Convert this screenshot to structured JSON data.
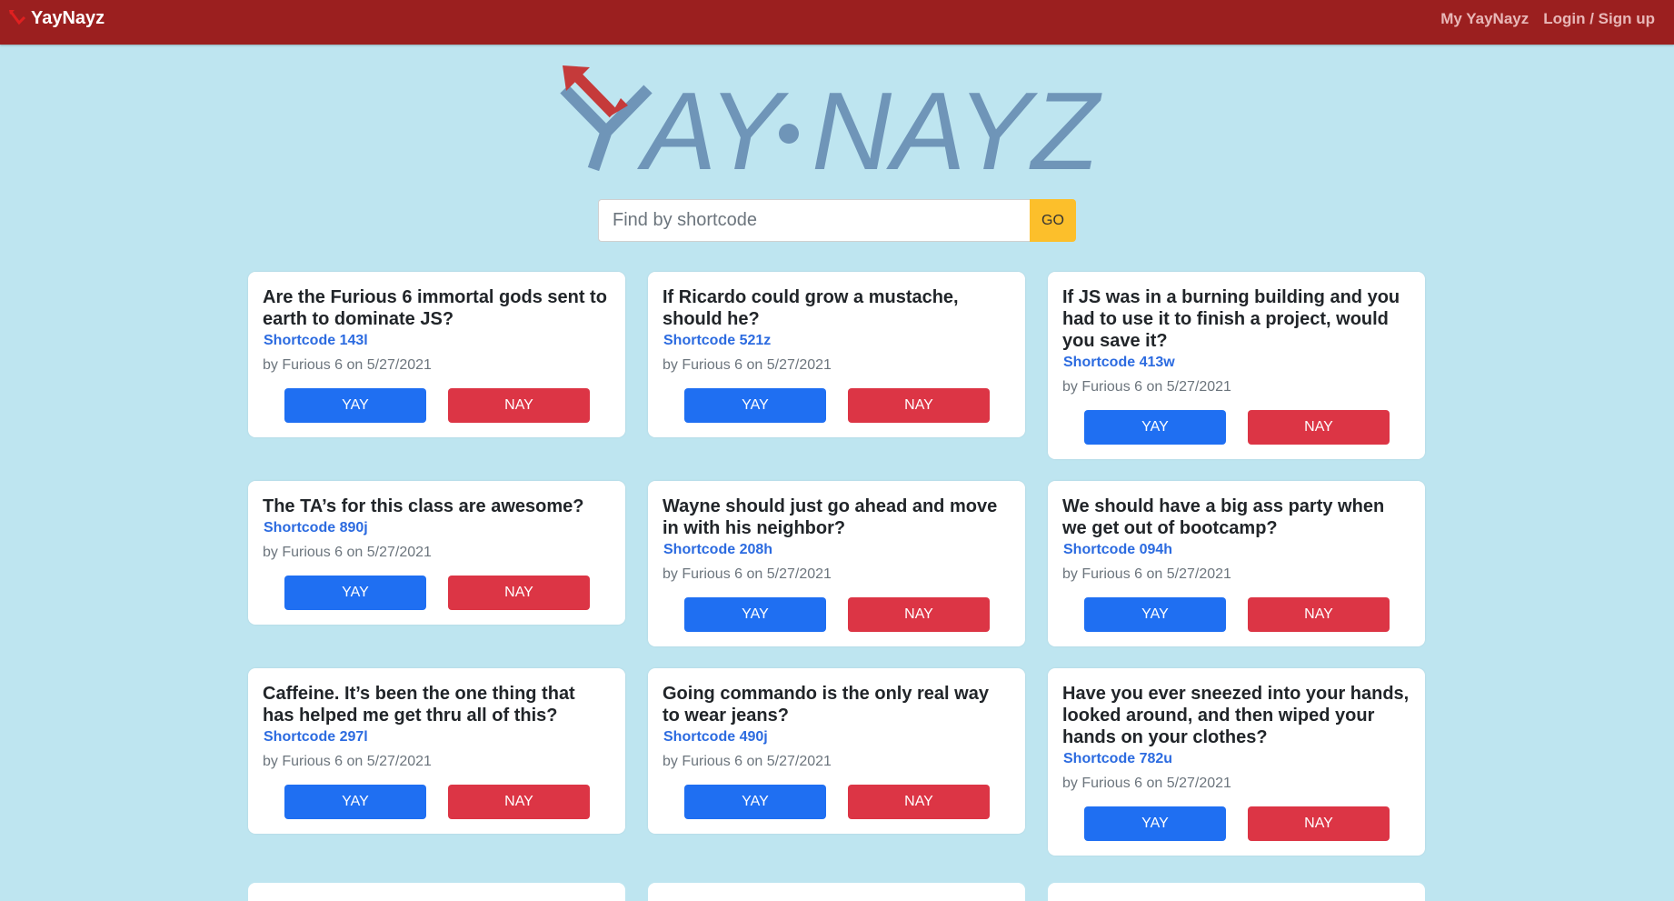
{
  "header": {
    "brand": "YayNayz",
    "nav": [
      {
        "label": "My YayNayz"
      },
      {
        "label": "Login / Sign up"
      }
    ]
  },
  "logo": {
    "text_left": "YAY",
    "text_right": "NAYZ",
    "color": "#6f95b8",
    "arrow_color": "#c53a3a"
  },
  "search": {
    "placeholder": "Find by shortcode",
    "value": "",
    "button_label": "GO"
  },
  "colors": {
    "navbar": "#9b1f1f",
    "background": "#bee5f0",
    "yay": "#1f6ff2",
    "nay": "#dc3545",
    "go": "#fcbf2b",
    "shortcode": "#2c6be0"
  },
  "cards": [
    {
      "question": "Are the Furious 6 immortal gods sent to earth to dominate JS?",
      "shortcode": "Shortcode 143l",
      "byline": "by Furious 6 on 5/27/2021",
      "yay": "YAY",
      "nay": "NAY"
    },
    {
      "question": "If Ricardo could grow a mustache, should he?",
      "shortcode": "Shortcode 521z",
      "byline": "by Furious 6 on 5/27/2021",
      "yay": "YAY",
      "nay": "NAY"
    },
    {
      "question": "If JS was in a burning building and you had to use it to finish a project, would you save it?",
      "shortcode": "Shortcode 413w",
      "byline": "by Furious 6 on 5/27/2021",
      "yay": "YAY",
      "nay": "NAY"
    },
    {
      "question": "The TA’s for this class are awesome?",
      "shortcode": "Shortcode 890j",
      "byline": "by Furious 6 on 5/27/2021",
      "yay": "YAY",
      "nay": "NAY"
    },
    {
      "question": "Wayne should just go ahead and move in with his neighbor?",
      "shortcode": "Shortcode 208h",
      "byline": "by Furious 6 on 5/27/2021",
      "yay": "YAY",
      "nay": "NAY"
    },
    {
      "question": "We should have a big ass party when we get out of bootcamp?",
      "shortcode": "Shortcode 094h",
      "byline": "by Furious 6 on 5/27/2021",
      "yay": "YAY",
      "nay": "NAY"
    },
    {
      "question": "Caffeine. It’s been the one thing that has helped me get thru all of this?",
      "shortcode": "Shortcode 297l",
      "byline": "by Furious 6 on 5/27/2021",
      "yay": "YAY",
      "nay": "NAY"
    },
    {
      "question": "Going commando is the only real way to wear jeans?",
      "shortcode": "Shortcode 490j",
      "byline": "by Furious 6 on 5/27/2021",
      "yay": "YAY",
      "nay": "NAY"
    },
    {
      "question": "Have you ever sneezed into your hands, looked around, and then wiped your hands on your clothes?",
      "shortcode": "Shortcode 782u",
      "byline": "by Furious 6 on 5/27/2021",
      "yay": "YAY",
      "nay": "NAY"
    }
  ]
}
